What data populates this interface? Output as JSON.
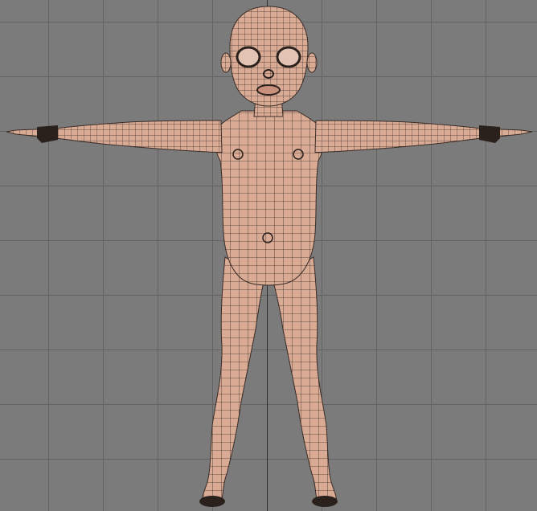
{
  "viewport": {
    "view": "front-orthographic",
    "background_color": "#7b7b7b",
    "grid_color": "#636363",
    "axis_color": "#2e2e2e"
  },
  "model": {
    "subject": "child-character-base-mesh",
    "pose": "t-pose",
    "display": "wireframe-over-solid",
    "skin_color": "#d9ab95",
    "wire_color": "#3a2c27"
  }
}
